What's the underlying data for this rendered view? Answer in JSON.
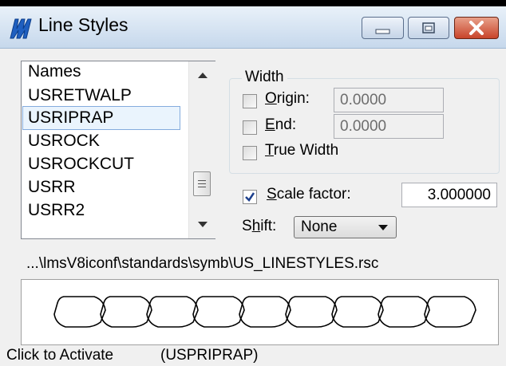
{
  "window": {
    "title": "Line Styles",
    "icon": "microstation-app-icon"
  },
  "title_buttons": [
    "minimize-icon",
    "maximize-icon",
    "close-icon"
  ],
  "names_list": {
    "header": "Names",
    "items": [
      "USRETWALP",
      "USRIPRAP",
      "USROCK",
      "USROCKCUT",
      "USRR",
      "USRR2"
    ],
    "selected": "USRIPRAP"
  },
  "width_group": {
    "label": "Width",
    "origin": {
      "label_u": "O",
      "label_rest": "rigin:",
      "checked": false,
      "value": "0.0000"
    },
    "end": {
      "label_u": "E",
      "label_rest": "nd:",
      "checked": false,
      "value": "0.0000"
    },
    "true_width": {
      "label_u": "T",
      "label_rest": "rue Width",
      "checked": false
    }
  },
  "scale_factor": {
    "label_u": "S",
    "label_rest": "cale factor:",
    "checked": true,
    "value": "3.000000"
  },
  "shift": {
    "label_pre": "S",
    "label_u": "h",
    "label_rest": "ift:",
    "value": "None"
  },
  "file_path": "...\\lmsV8iconf\\standards\\symb\\US_LINESTYLES.rsc",
  "preview": {
    "pattern": "riprap-rounded-blocks"
  },
  "status": {
    "left": "Click to Activate",
    "right": "(USPRIPRAP)"
  }
}
